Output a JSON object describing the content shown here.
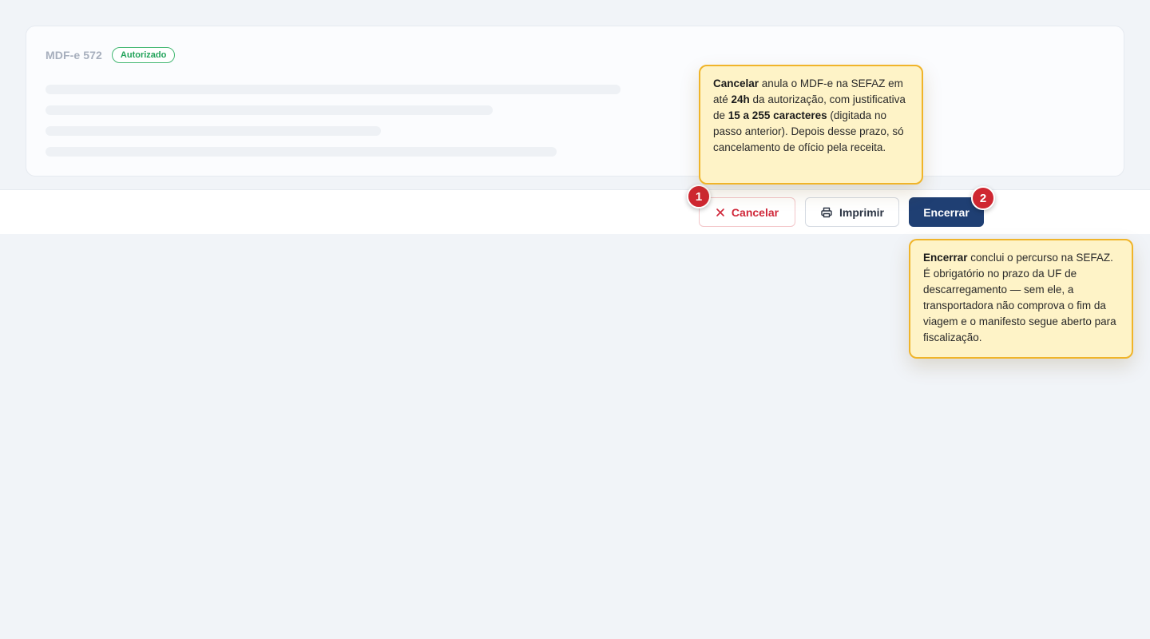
{
  "card": {
    "title": "MDF-e 572",
    "status_badge": "Autorizado"
  },
  "actions": {
    "cancel_label": "Cancelar",
    "print_label": "Imprimir",
    "close_label": "Encerrar"
  },
  "steps": {
    "first": "1",
    "second": "2"
  },
  "tooltips": {
    "cancel": {
      "t1": "Cancelar",
      "t2": " anula o MDF-e na SEFAZ em até ",
      "t3": "24h",
      "t4": " da autorização, com justificativa de ",
      "t5": "15 a 255 caracteres",
      "t6": " (digitada no passo anterior). Depois desse prazo, só cancelamento de ofício pela receita."
    },
    "close": {
      "t1": "Encerrar",
      "t2": " conclui o percurso na SEFAZ. É obrigatório no prazo da UF de descarregamento — sem ele, a transportadora não comprova o fim da viagem e o manifesto segue aberto para fiscalização."
    }
  },
  "icons": {
    "cancel": "x-icon",
    "print": "printer-icon"
  },
  "colors": {
    "primary": "#1f3f73",
    "danger": "#d0283a",
    "success": "#22a35a",
    "tooltip_bg": "#fef3c7",
    "tooltip_border": "#f0b429"
  }
}
